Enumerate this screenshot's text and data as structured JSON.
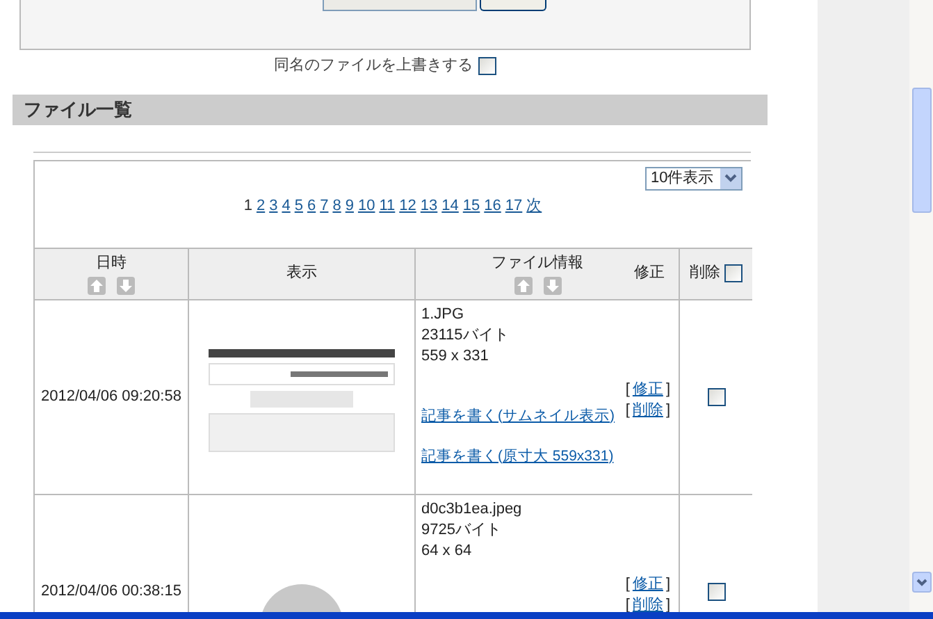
{
  "overwrite": {
    "label": "同名のファイルを上書きする",
    "checked": false
  },
  "section_title": "ファイル一覧",
  "per_page": "10件表示",
  "pagination": [
    {
      "label": "1",
      "selected": true
    },
    {
      "label": "2",
      "selected": false
    },
    {
      "label": "3",
      "selected": false
    },
    {
      "label": "4",
      "selected": false
    },
    {
      "label": "5",
      "selected": false
    },
    {
      "label": "6",
      "selected": false
    },
    {
      "label": "7",
      "selected": false
    },
    {
      "label": "8",
      "selected": false
    },
    {
      "label": "9",
      "selected": false
    },
    {
      "label": "10",
      "selected": false
    },
    {
      "label": "11",
      "selected": false
    },
    {
      "label": "12",
      "selected": false
    },
    {
      "label": "13",
      "selected": false
    },
    {
      "label": "14",
      "selected": false
    },
    {
      "label": "15",
      "selected": false
    },
    {
      "label": "16",
      "selected": false
    },
    {
      "label": "17",
      "selected": false
    },
    {
      "label": "次",
      "selected": false
    }
  ],
  "header": {
    "date": "日時",
    "preview": "表示",
    "file_info": "ファイル情報",
    "edit": "修正",
    "delete": "削除",
    "delete_all_checked": false
  },
  "rows": [
    {
      "date": "2012/04/06 09:20:58",
      "kind": "screenshot",
      "filename": "1.JPG",
      "size": "23115バイト",
      "dimensions": "559 x 331",
      "bracket_open": "[",
      "edit": "修正",
      "delete": "削除",
      "bracket_close": "]",
      "links": [
        "記事を書く(サムネイル表示)",
        "記事を書く(原寸大 559x331)"
      ],
      "checked": false
    },
    {
      "date": "2012/04/06 00:38:15",
      "kind": "illustration",
      "filename": "d0c3b1ea.jpeg",
      "size": "9725バイト",
      "dimensions": "64 x 64",
      "bracket_open": "[",
      "edit": "修正",
      "delete": "削除",
      "bracket_close": "]",
      "links": [],
      "checked": false
    }
  ]
}
